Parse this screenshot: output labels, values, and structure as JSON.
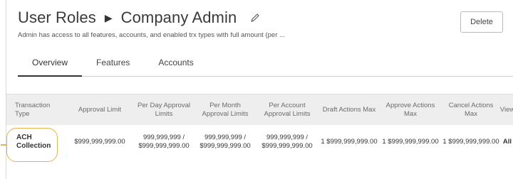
{
  "header": {
    "title_parent": "User Roles",
    "title_current": "Company Admin",
    "subtitle": "Admin has access to all features, accounts, and enabled trx types with full amount (per ..."
  },
  "actions": {
    "delete_label": "Delete"
  },
  "tabs": [
    {
      "label": "Overview",
      "active": true
    },
    {
      "label": "Features",
      "active": false
    },
    {
      "label": "Accounts",
      "active": false
    }
  ],
  "table": {
    "headers": [
      "Transaction Type",
      "Approval Limit",
      "Per Day Approval Limits",
      "Per Month Approval Limits",
      "Per Account Approval Limits",
      "Draft Actions Max",
      "Approve Actions Max",
      "Cancel Actions Max",
      "View"
    ],
    "rows": [
      {
        "transaction_type": "ACH Collection",
        "approval_limit": "$999,999,999.00",
        "per_day": "999,999,999 / $999,999,999.00",
        "per_month": "999,999,999 / $999,999,999.00",
        "per_account": "999,999,999 / $999,999,999.00",
        "draft_max": "1 $999,999,999.00",
        "approve_max": "1 $999,999,999.00",
        "cancel_max": "1 $999,999,999.00",
        "view": "All"
      }
    ]
  },
  "colors": {
    "highlight": "#e6b24a",
    "header_bg": "#eeeeee"
  },
  "icons": {
    "edit": "pencil-icon",
    "breadcrumb_separator": "caret-right-icon"
  }
}
